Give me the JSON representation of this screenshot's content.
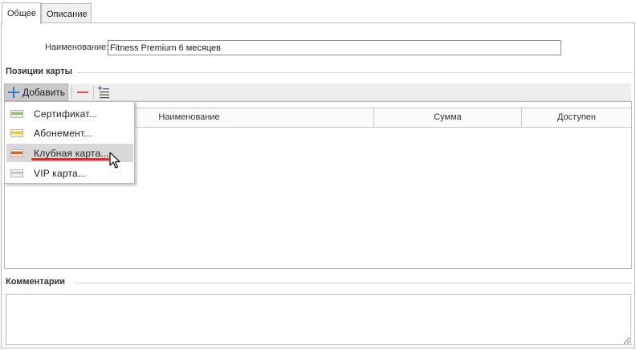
{
  "tabs": [
    {
      "label": "Общее",
      "active": true
    },
    {
      "label": "Описание",
      "active": false
    }
  ],
  "name_field": {
    "label": "Наименование:",
    "value": "Fitness Premium 6 месяцев"
  },
  "positions_group": {
    "title": "Позиции карты"
  },
  "toolbar": {
    "add_label": "Добавить",
    "remove_icon": "minus-icon",
    "list_icon": "add-list-icon"
  },
  "grid": {
    "columns": [
      "Наименование",
      "Сумма",
      "Доступен"
    ]
  },
  "add_menu": {
    "items": [
      {
        "label": "Сертификат...",
        "icon": "green-card-icon",
        "color": "#8cc46c"
      },
      {
        "label": "Абонемент...",
        "icon": "yellow-card-icon",
        "color": "#f0c840"
      },
      {
        "label": "Клубная карта...",
        "icon": "orange-card-icon",
        "color": "#d0682c",
        "highlighted": true
      },
      {
        "label": "VIP карта...",
        "icon": "gray-card-icon",
        "color": "#c8c8c8"
      }
    ]
  },
  "comments_group": {
    "title": "Комментарии"
  },
  "accent": "#3a78c4",
  "highlight_color": "#e8262a"
}
